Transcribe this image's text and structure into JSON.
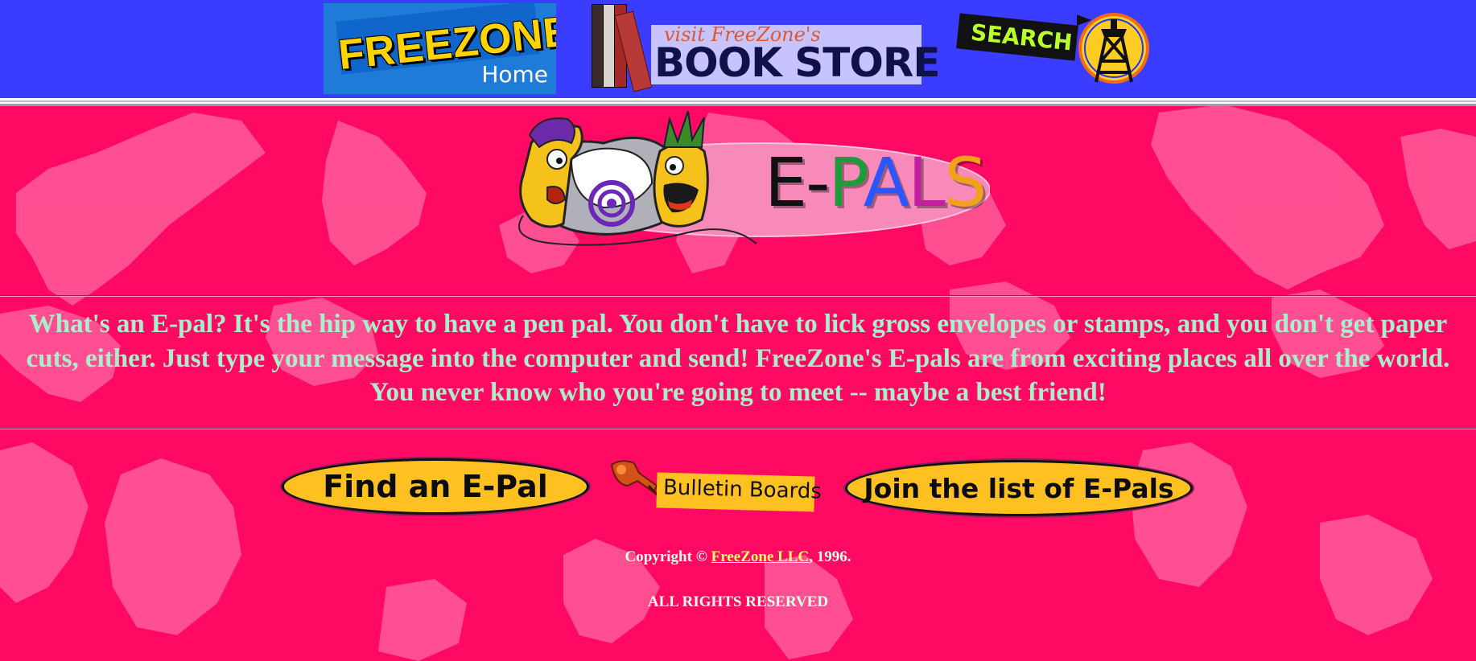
{
  "colors": {
    "page_background": "#ff0a63",
    "map_shapes": "#ff5c9a",
    "top_bar": "#3a3cff",
    "description_text": "#a8f0cc",
    "button_fill": "#ffc022",
    "footer_text": "#d8ffe8",
    "footer_link": "#ffff66"
  },
  "header": {
    "home": {
      "logo_text": "FREEZONE",
      "sub_text": "Home",
      "icon": "freezone-home-logo"
    },
    "bookstore": {
      "line1": "visit FreeZone's",
      "line2": "BOOK STORE",
      "icon": "books-icon"
    },
    "search": {
      "label": "SEARCH",
      "icon": "watchtower-icon"
    }
  },
  "logo": {
    "title": "E-PALS",
    "icon": "two-faces-talking-icon"
  },
  "description": "What's an E-pal? It's the hip way to have a pen pal. You don't have to lick gross envelopes or stamps, and you don't get paper cuts, either. Just type your message into the computer and send! FreeZone's E-pals are from exciting places all over the world. You never know who you're going to meet -- maybe a best friend!",
  "actions": {
    "find": "Find an E-Pal",
    "bulletin": "Bulletin Boards",
    "bulletin_icon": "pushpin-icon",
    "join": "Join the list of E-Pals"
  },
  "footer": {
    "copyright_prefix": "Copyright © ",
    "company_link": "FreeZone LLC",
    "copyright_suffix": ", 1996.",
    "rights": "ALL RIGHTS RESERVED"
  }
}
